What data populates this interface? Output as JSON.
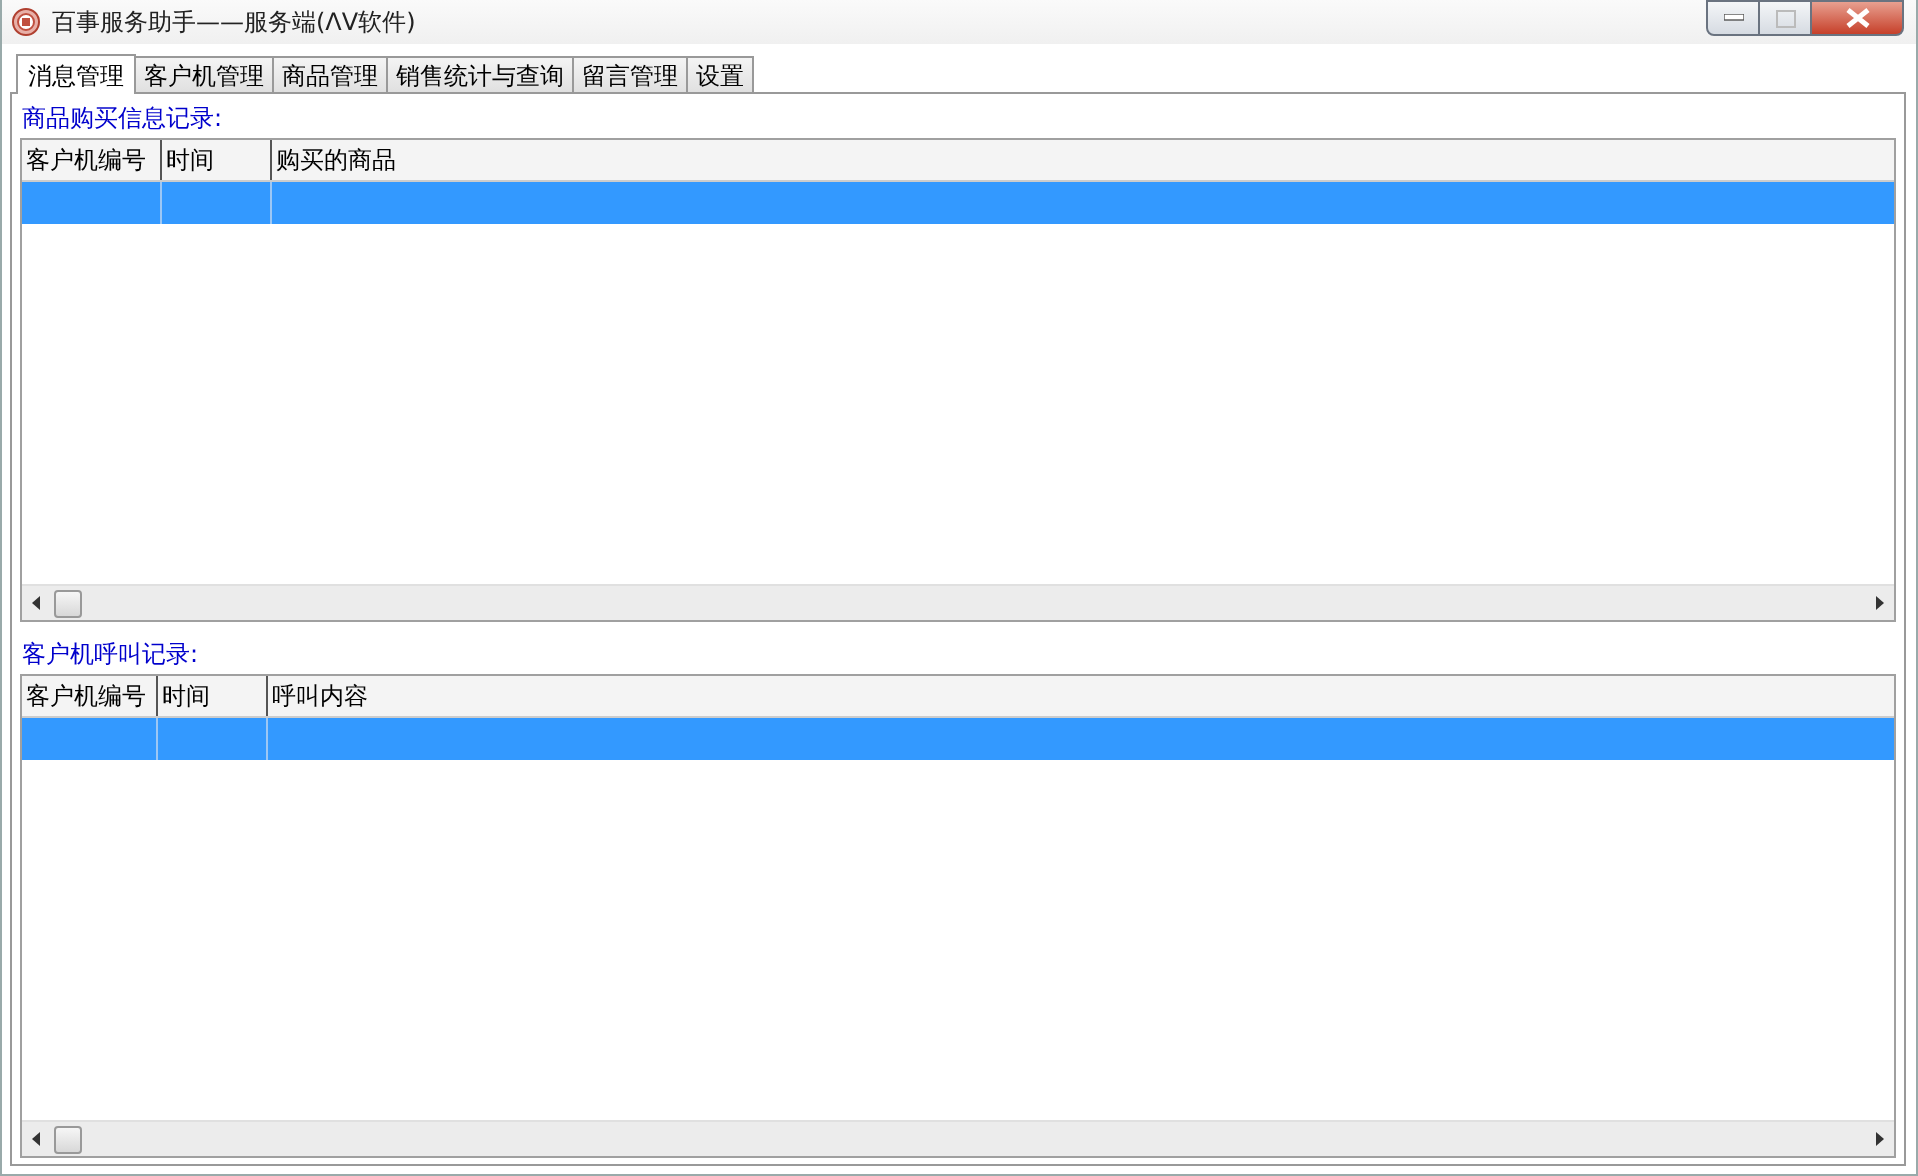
{
  "window": {
    "title": "百事服务助手——服务端(ΛV软件)"
  },
  "tabs": [
    {
      "label": "消息管理",
      "selected": true
    },
    {
      "label": "客户机管理",
      "selected": false
    },
    {
      "label": "商品管理",
      "selected": false
    },
    {
      "label": "销售统计与查询",
      "selected": false
    },
    {
      "label": "留言管理",
      "selected": false
    },
    {
      "label": "设置",
      "selected": false
    }
  ],
  "sections": [
    {
      "label": "商品购买信息记录:",
      "columns": [
        "客户机编号",
        "时间",
        "购买的商品"
      ],
      "rows": [
        {
          "selected": true
        }
      ]
    },
    {
      "label": "客户机呼叫记录:",
      "columns": [
        "客户机编号",
        "时间",
        "呼叫内容"
      ],
      "rows": [
        {
          "selected": true
        }
      ]
    }
  ]
}
